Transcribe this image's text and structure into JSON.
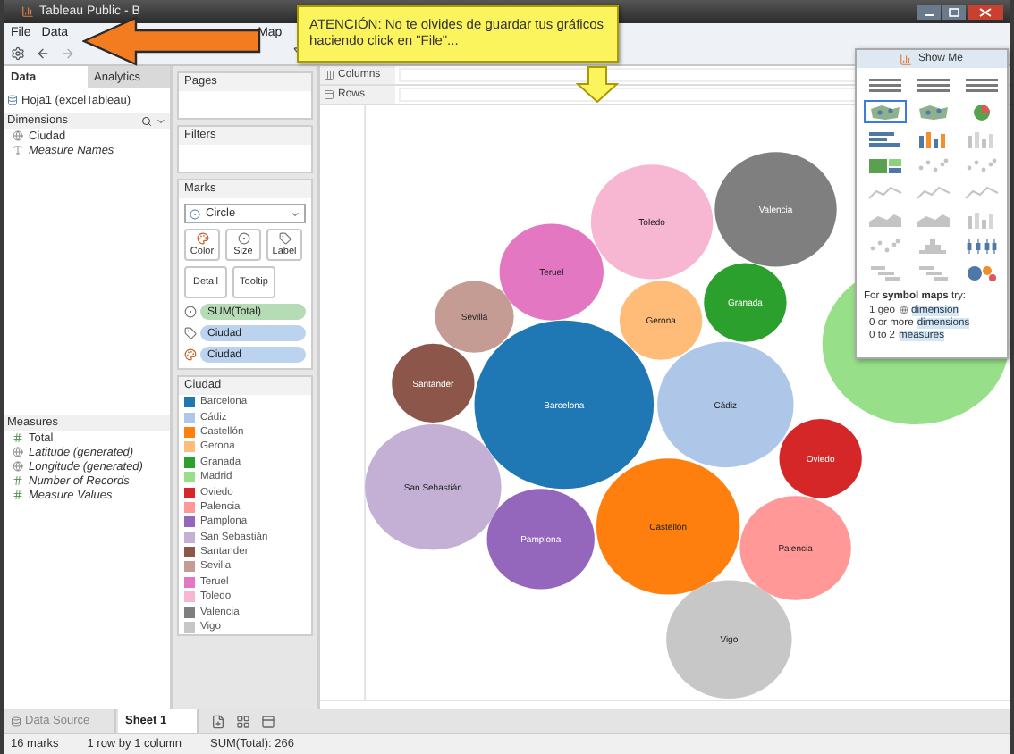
{
  "window": {
    "title": "Tableau Public - B"
  },
  "menu": [
    {
      "label": "File"
    },
    {
      "label": "Data"
    },
    {
      "label": "Map"
    }
  ],
  "callout": {
    "text": "ATENCIÓN: No te olvides de guardar tus gráficos haciendo click en \"File\"..."
  },
  "data_pane": {
    "tabs": [
      {
        "label": "Data",
        "selected": true
      },
      {
        "label": "Analytics",
        "selected": false
      }
    ],
    "source": "Hoja1 (excelTableau)",
    "dimensions": {
      "title": "Dimensions",
      "items": [
        {
          "label": "Ciudad",
          "kind": "geo",
          "italic": false
        },
        {
          "label": "Measure Names",
          "kind": "text",
          "italic": true
        }
      ]
    },
    "measures": {
      "title": "Measures",
      "items": [
        {
          "label": "Total",
          "kind": "number",
          "italic": false
        },
        {
          "label": "Latitude (generated)",
          "kind": "geo",
          "italic": true
        },
        {
          "label": "Longitude (generated)",
          "kind": "geo",
          "italic": true
        },
        {
          "label": "Number of Records",
          "kind": "number",
          "italic": true
        },
        {
          "label": "Measure Values",
          "kind": "number",
          "italic": true
        }
      ]
    }
  },
  "shelves": {
    "pages": "Pages",
    "filters": "Filters",
    "columns": "Columns",
    "rows": "Rows"
  },
  "marks": {
    "title": "Marks",
    "type": "Circle",
    "buttons": [
      "Color",
      "Size",
      "Label",
      "Detail",
      "Tooltip"
    ],
    "pills": [
      {
        "label": "SUM(Total)",
        "kind": "size"
      },
      {
        "label": "Ciudad",
        "kind": "label"
      },
      {
        "label": "Ciudad",
        "kind": "color"
      }
    ]
  },
  "legend": {
    "title": "Ciudad",
    "items": [
      {
        "label": "Barcelona",
        "color": "#1f77b4"
      },
      {
        "label": "Cádiz",
        "color": "#aec7e8"
      },
      {
        "label": "Castellón",
        "color": "#ff7f0e"
      },
      {
        "label": "Gerona",
        "color": "#ffbb78"
      },
      {
        "label": "Granada",
        "color": "#2ca02c"
      },
      {
        "label": "Madrid",
        "color": "#98df8a"
      },
      {
        "label": "Oviedo",
        "color": "#d62728"
      },
      {
        "label": "Palencia",
        "color": "#ff9896"
      },
      {
        "label": "Pamplona",
        "color": "#9467bd"
      },
      {
        "label": "San Sebastián",
        "color": "#c5b0d5"
      },
      {
        "label": "Santander",
        "color": "#8c564b"
      },
      {
        "label": "Sevilla",
        "color": "#c49c94"
      },
      {
        "label": "Teruel",
        "color": "#e377c2"
      },
      {
        "label": "Toledo",
        "color": "#f7b6d2"
      },
      {
        "label": "Valencia",
        "color": "#7f7f7f"
      },
      {
        "label": "Vigo",
        "color": "#c7c7c7"
      }
    ]
  },
  "bubbles": [
    {
      "label": "Barcelona",
      "color": "#1f77b4"
    },
    {
      "label": "Cádiz",
      "color": "#aec7e8"
    },
    {
      "label": "Castellón",
      "color": "#ff7f0e"
    },
    {
      "label": "Gerona",
      "color": "#ffbb78"
    },
    {
      "label": "Granada",
      "color": "#2ca02c"
    },
    {
      "color": "#98df8a"
    },
    {
      "label": "Oviedo",
      "color": "#d62728"
    },
    {
      "label": "Palencia",
      "color": "#ff9896"
    },
    {
      "label": "Pamplona",
      "color": "#9467bd"
    },
    {
      "label": "San Sebastián",
      "color": "#c5b0d5"
    },
    {
      "label": "Santander",
      "color": "#8c564b"
    },
    {
      "label": "Sevilla",
      "color": "#c49c94"
    },
    {
      "label": "Teruel",
      "color": "#e377c2"
    },
    {
      "label": "Toledo",
      "color": "#f7b6d2"
    },
    {
      "label": "Valencia",
      "color": "#7f7f7f"
    },
    {
      "label": "Vigo",
      "color": "#c7c7c7"
    }
  ],
  "show_me": {
    "title": "Show Me",
    "charts": [
      {
        "kind": "table",
        "selected": false,
        "disabled": false
      },
      {
        "kind": "table",
        "selected": false,
        "disabled": false
      },
      {
        "kind": "table",
        "selected": false,
        "disabled": false
      },
      {
        "kind": "map",
        "selected": true,
        "disabled": false
      },
      {
        "kind": "map",
        "selected": false,
        "disabled": false
      },
      {
        "kind": "pie",
        "selected": false,
        "disabled": false
      },
      {
        "kind": "hbar",
        "selected": false,
        "disabled": false
      },
      {
        "kind": "vbar",
        "selected": false,
        "disabled": false
      },
      {
        "kind": "vbar",
        "selected": false,
        "disabled": true
      },
      {
        "kind": "treemap",
        "selected": false,
        "disabled": false
      },
      {
        "kind": "dots",
        "selected": false,
        "disabled": true
      },
      {
        "kind": "dots",
        "selected": false,
        "disabled": true
      },
      {
        "kind": "line",
        "selected": false,
        "disabled": true
      },
      {
        "kind": "line",
        "selected": false,
        "disabled": true
      },
      {
        "kind": "line",
        "selected": false,
        "disabled": true
      },
      {
        "kind": "area",
        "selected": false,
        "disabled": true
      },
      {
        "kind": "area",
        "selected": false,
        "disabled": true
      },
      {
        "kind": "vbar",
        "selected": false,
        "disabled": true
      },
      {
        "kind": "dots",
        "selected": false,
        "disabled": true
      },
      {
        "kind": "histogram",
        "selected": false,
        "disabled": true
      },
      {
        "kind": "box",
        "selected": false,
        "disabled": false
      },
      {
        "kind": "gantt",
        "selected": false,
        "disabled": true
      },
      {
        "kind": "gantt",
        "selected": false,
        "disabled": true
      },
      {
        "kind": "bubbles",
        "selected": false,
        "disabled": false
      }
    ],
    "hint": "For **symbol maps** try:",
    "requirements": [
      {
        "count": "1 geo",
        "term": "dimension",
        "geo": true
      },
      {
        "count": "0 or more",
        "term": "dimensions"
      },
      {
        "count": "0 to 2",
        "term": "measures"
      }
    ]
  },
  "sheet_tabs": [
    {
      "label": "Data Source",
      "kind": "source",
      "selected": false
    },
    {
      "label": "Sheet 1",
      "kind": "sheet",
      "selected": true
    }
  ],
  "status_bar": [
    "16 marks",
    "1 row by 1 column",
    "SUM(Total): 266"
  ]
}
